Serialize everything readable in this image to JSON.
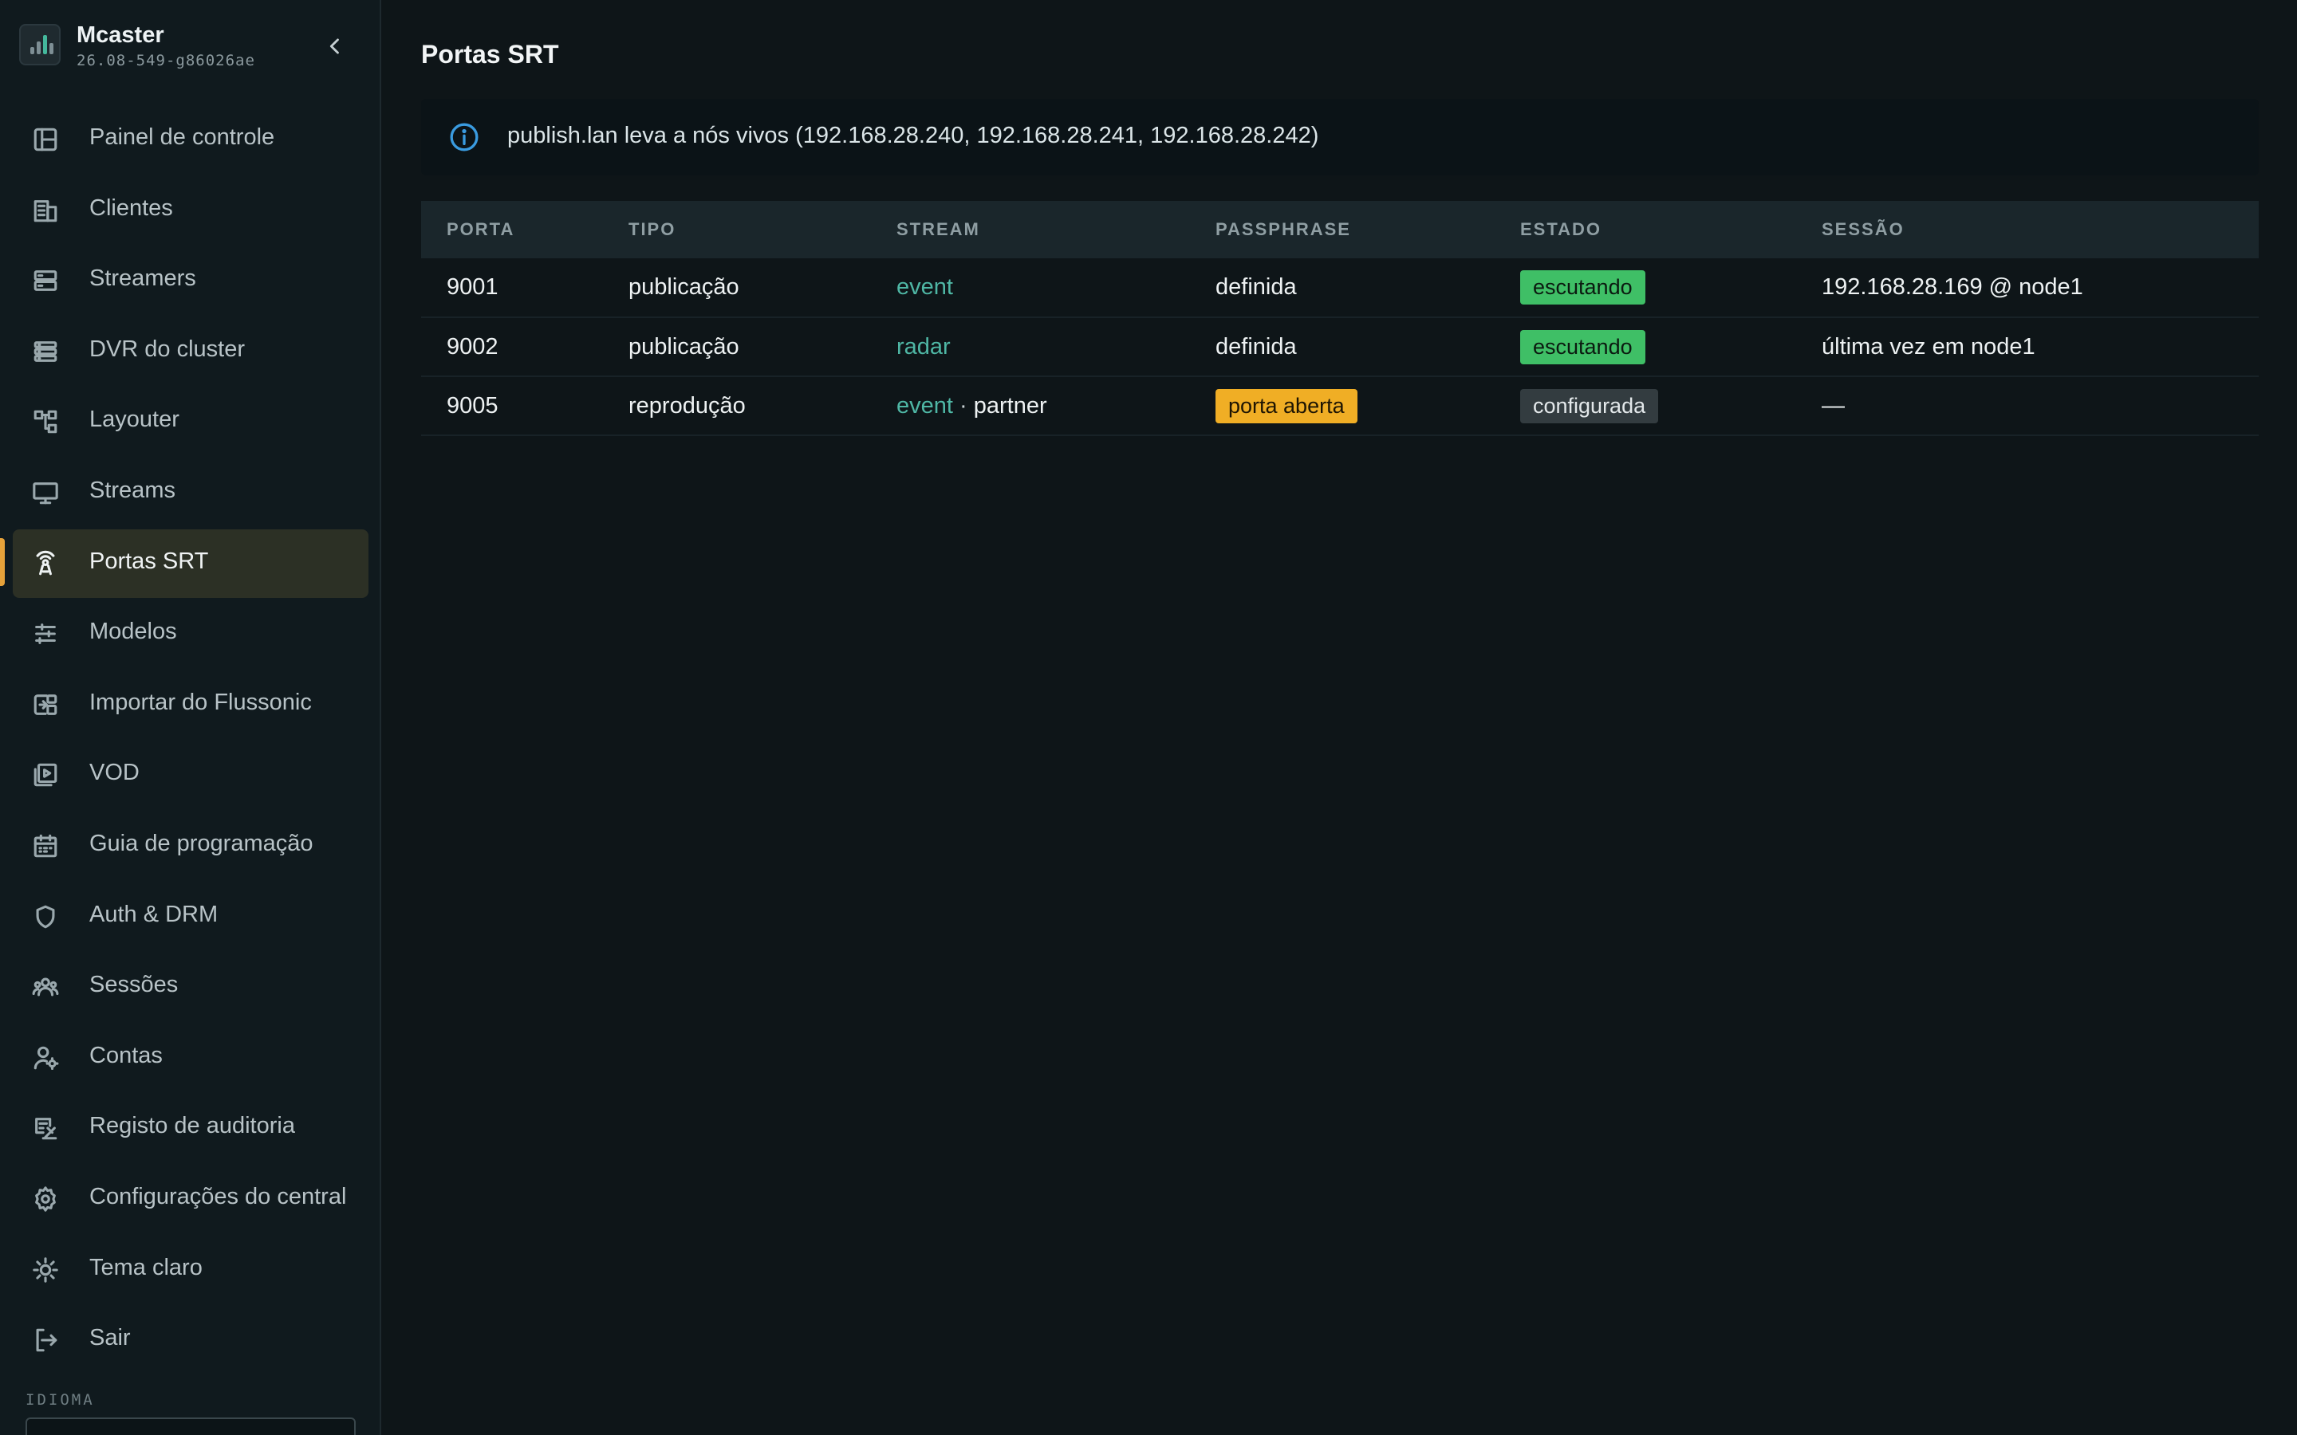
{
  "brand": {
    "name": "Mcaster",
    "version": "26.08-549-g86026ae"
  },
  "sidebar": {
    "items": [
      {
        "label": "Painel de controle",
        "icon": "dashboard-icon"
      },
      {
        "label": "Clientes",
        "icon": "building-icon"
      },
      {
        "label": "Streamers",
        "icon": "server-icon"
      },
      {
        "label": "DVR do cluster",
        "icon": "database-icon"
      },
      {
        "label": "Layouter",
        "icon": "layout-icon"
      },
      {
        "label": "Streams",
        "icon": "monitor-icon"
      },
      {
        "label": "Portas SRT",
        "icon": "broadcast-icon",
        "active": true
      },
      {
        "label": "Modelos",
        "icon": "sliders-icon"
      },
      {
        "label": "Importar do Flussonic",
        "icon": "import-icon"
      },
      {
        "label": "VOD",
        "icon": "video-library-icon"
      },
      {
        "label": "Guia de programação",
        "icon": "calendar-icon"
      },
      {
        "label": "Auth & DRM",
        "icon": "shield-icon"
      },
      {
        "label": "Sessões",
        "icon": "users-icon"
      },
      {
        "label": "Contas",
        "icon": "user-gear-icon"
      },
      {
        "label": "Registo de auditoria",
        "icon": "audit-icon"
      },
      {
        "label": "Configurações do central",
        "icon": "gear-icon"
      },
      {
        "label": "Tema claro",
        "icon": "sun-icon"
      },
      {
        "label": "Sair",
        "icon": "logout-icon"
      }
    ],
    "language_label": "IDIOMA"
  },
  "page": {
    "title": "Portas SRT",
    "info": "publish.lan leva a nós vivos (192.168.28.240, 192.168.28.241, 192.168.28.242)"
  },
  "table": {
    "headers": [
      "PORTA",
      "TIPO",
      "STREAM",
      "PASSPHRASE",
      "ESTADO",
      "SESSÃO"
    ],
    "rows": [
      {
        "port": "9001",
        "type": "publicação",
        "stream": "event",
        "stream_extra": "",
        "passphrase": "definida",
        "passphrase_badge": false,
        "state": "escutando",
        "state_style": "green",
        "session": "192.168.28.169 @ node1",
        "session_muted": false
      },
      {
        "port": "9002",
        "type": "publicação",
        "stream": "radar",
        "stream_extra": "",
        "passphrase": "definida",
        "passphrase_badge": false,
        "state": "escutando",
        "state_style": "green",
        "session": "última vez em node1",
        "session_muted": true
      },
      {
        "port": "9005",
        "type": "reprodução",
        "stream": "event",
        "stream_extra": "partner",
        "passphrase": "porta aberta",
        "passphrase_badge": true,
        "state": "configurada",
        "state_style": "gray",
        "session": "—",
        "session_muted": false
      }
    ]
  },
  "colors": {
    "accent": "#e6a23a",
    "link": "#4fb7a5",
    "listening": "#3fbf66",
    "open_port": "#f0ae25",
    "info": "#3a9be0"
  }
}
